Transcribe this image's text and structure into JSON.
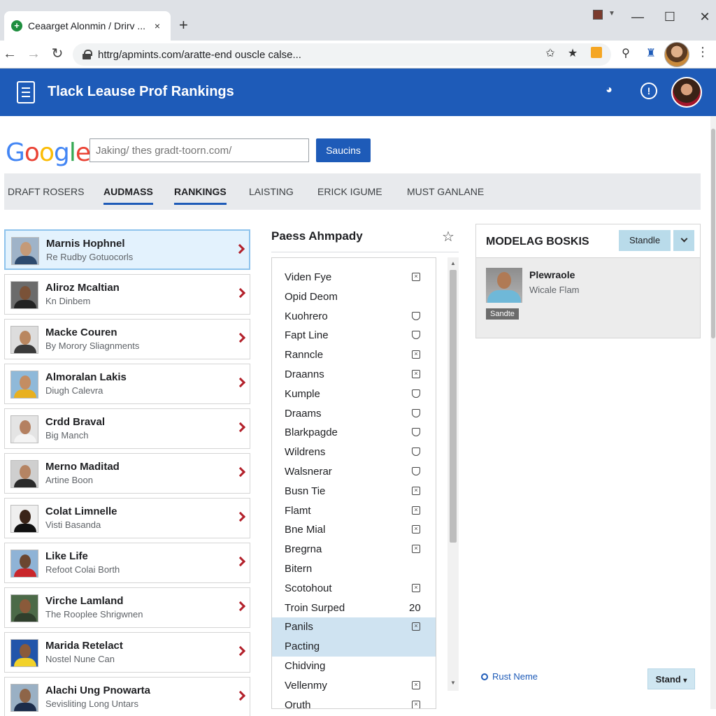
{
  "browser": {
    "tab_title": "Ceaarget Alonmin / Drirv ...",
    "tab_close": "×",
    "new_tab": "+",
    "url": "httrg/apmints.com/aratte-end ouscle calse...",
    "window": {
      "minimize": "—",
      "maximize": "☐",
      "close": "✕"
    }
  },
  "app": {
    "title": "Tlack Leause Prof Rankings"
  },
  "search": {
    "logo": "Google",
    "placeholder": "Jaking/ thes gradt-toorn.com/",
    "button": "Saucins"
  },
  "nav": {
    "tabs": [
      "DRAFT ROSERS",
      "AUDMASS",
      "RANKINGS",
      "LAISTING",
      "ERICK IGUME",
      "MUST GANLANE"
    ],
    "active": "AUDMASS"
  },
  "players": [
    {
      "name": "Marnis Hophnel",
      "sub": "Re Rudby Gotuocorls",
      "selected": true
    },
    {
      "name": "Aliroz Mcaltian",
      "sub": "Kn Dinbem"
    },
    {
      "name": "Macke Couren",
      "sub": "By Morory Sliagnments"
    },
    {
      "name": "Almoralan Lakis",
      "sub": "Diugh Calevra"
    },
    {
      "name": "Crdd Braval",
      "sub": "Big Manch"
    },
    {
      "name": "Merno Maditad",
      "sub": "Artine Boon"
    },
    {
      "name": "Colat Limnelle",
      "sub": "Visti Basanda"
    },
    {
      "name": "Like Life",
      "sub": "Refoot Colai Borth"
    },
    {
      "name": "Virche Lamland",
      "sub": "The Rooplee Shrigwnen"
    },
    {
      "name": "Marida Retelact",
      "sub": "Nostel Nune Can"
    },
    {
      "name": "Alachi Ung Pnowarta",
      "sub": "Sevisliting Long Untars"
    }
  ],
  "positions": {
    "title": "Paess Ahmpady",
    "items": [
      {
        "label": "Viden Fye",
        "mark": "x"
      },
      {
        "label": "Opid Deom",
        "mark": ""
      },
      {
        "label": "Kuohrero",
        "mark": "shield"
      },
      {
        "label": "Fapt Line",
        "mark": "shield"
      },
      {
        "label": "Ranncle",
        "mark": "x"
      },
      {
        "label": "Draanns",
        "mark": "x"
      },
      {
        "label": "Kumple",
        "mark": "shield"
      },
      {
        "label": "Draams",
        "mark": "shield"
      },
      {
        "label": "Blarkpagde",
        "mark": "shield"
      },
      {
        "label": "Wildrens",
        "mark": "shield"
      },
      {
        "label": "Walsnerar",
        "mark": "shield"
      },
      {
        "label": "Busn Tie",
        "mark": "x"
      },
      {
        "label": "Flamt",
        "mark": "x"
      },
      {
        "label": "Bne Mial",
        "mark": "x"
      },
      {
        "label": "Bregrna",
        "mark": "x"
      },
      {
        "label": "Bitern",
        "mark": ""
      },
      {
        "label": "Scotohout",
        "mark": "x"
      },
      {
        "label": "Troin Surped",
        "mark": "20"
      },
      {
        "label": "Panils",
        "mark": "x",
        "selected": true
      },
      {
        "label": "Pacting",
        "mark": "",
        "selected": true
      },
      {
        "label": "Chidving",
        "mark": ""
      },
      {
        "label": "Vellenmy",
        "mark": "x"
      },
      {
        "label": "Oruth",
        "mark": "x"
      }
    ]
  },
  "detail": {
    "title": "MODELAG BOSKIS",
    "stand_button": "Standle",
    "player_name": "Plewraole",
    "player_sub": "Wicale Flam",
    "badge": "Sandte"
  },
  "footer": {
    "link": "Rust Neme",
    "stand_button": "Stand"
  },
  "colors": {
    "header_blue": "#1e5bb8",
    "chevron_red": "#b3202a",
    "selected_bg": "#e3f2fd"
  }
}
